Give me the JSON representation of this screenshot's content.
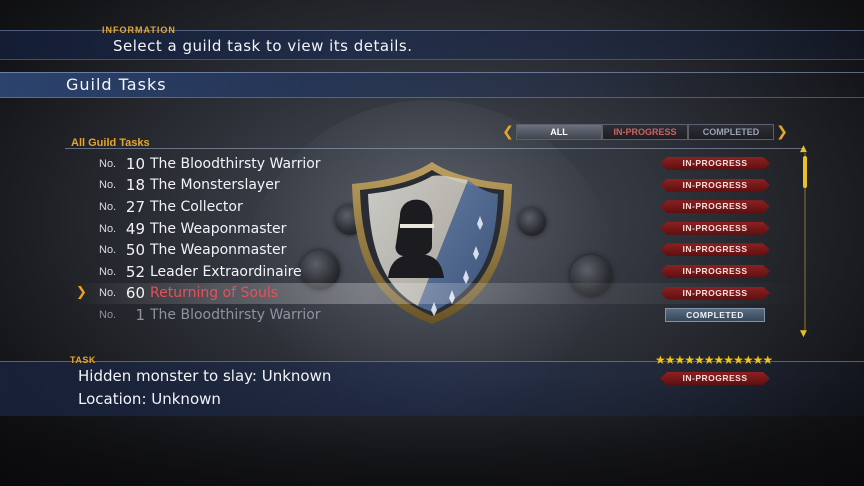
{
  "information": {
    "label": "INFORMATION",
    "text": "Select a guild task to view its details."
  },
  "header": {
    "title": "Guild Tasks"
  },
  "filter": {
    "tabs": [
      "ALL",
      "IN-PROGRESS",
      "COMPLETED"
    ],
    "selected": "ALL"
  },
  "list": {
    "label": "All Guild Tasks",
    "no_prefix": "No.",
    "rows": [
      {
        "num": "10",
        "name": "The Bloodthirsty Warrior",
        "status": "IN-PROGRESS"
      },
      {
        "num": "18",
        "name": "The Monsterslayer",
        "status": "IN-PROGRESS"
      },
      {
        "num": "27",
        "name": "The Collector",
        "status": "IN-PROGRESS"
      },
      {
        "num": "49",
        "name": "The Weaponmaster",
        "status": "IN-PROGRESS"
      },
      {
        "num": "50",
        "name": "The Weaponmaster",
        "status": "IN-PROGRESS"
      },
      {
        "num": "52",
        "name": "Leader Extraordinaire",
        "status": "IN-PROGRESS"
      },
      {
        "num": "60",
        "name": "Returning of Souls",
        "status": "IN-PROGRESS",
        "selected": true
      },
      {
        "num": "1",
        "name": "The Bloodthirsty Warrior",
        "status": "COMPLETED",
        "dim": true
      }
    ]
  },
  "task": {
    "label": "TASK",
    "line1": "Hidden monster to slay: Unknown",
    "line2": "Location: Unknown",
    "stars": "★★★★★★★★★★★★",
    "star_count": 12,
    "status": "IN-PROGRESS"
  },
  "colors": {
    "accent_gold": "#e7a52a",
    "in_progress_red": "#8e2020",
    "selected_name": "#e8505a",
    "completed_blue": "#5a6c80"
  }
}
